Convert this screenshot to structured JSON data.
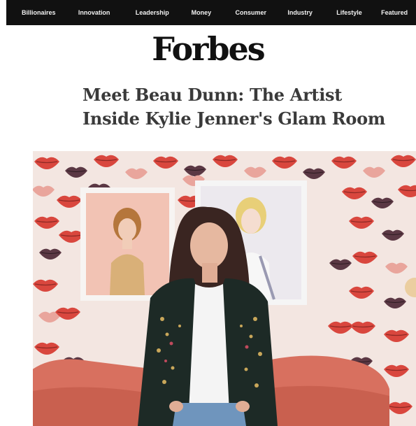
{
  "nav": {
    "items": [
      "Billionaires",
      "Innovation",
      "Leadership",
      "Money",
      "Consumer",
      "Industry",
      "Lifestyle",
      "Featured"
    ]
  },
  "brand": {
    "logo": "Forbes"
  },
  "article": {
    "headline_line1": "Meet Beau Dunn: The Artist",
    "headline_line2": "Inside Kylie Jenner's Glam Room"
  },
  "colors": {
    "nav_bg": "#111111",
    "headline": "#3a3a3a",
    "lips_red": "#d9473e",
    "wallpaper": "#f3e6e1"
  }
}
